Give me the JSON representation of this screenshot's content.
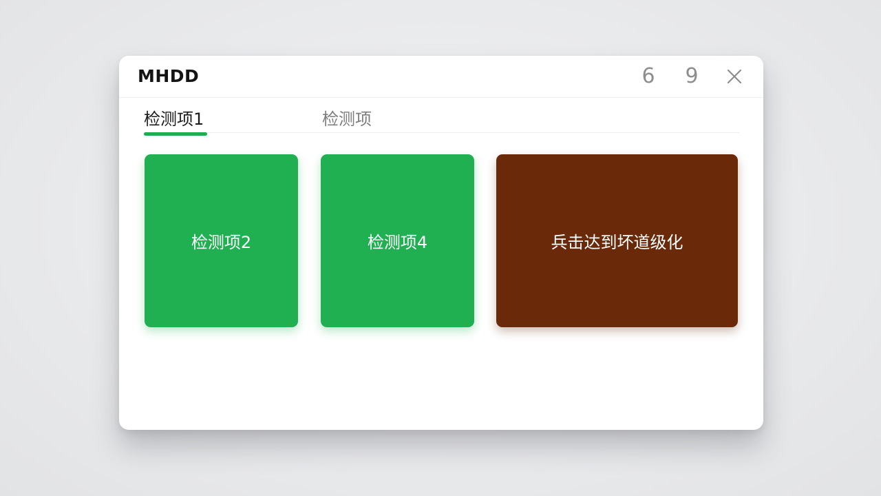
{
  "window": {
    "title": "MHDD",
    "controls": {
      "first": "6",
      "second": "9",
      "close_icon": "close-icon"
    }
  },
  "tabs": [
    {
      "label": "检测项1",
      "active": true
    },
    {
      "label": "检测项",
      "active": false
    }
  ],
  "cards": [
    {
      "label": "检测项2",
      "color": "#20b052"
    },
    {
      "label": "检测项4",
      "color": "#20b052"
    },
    {
      "label": "兵击达到坏道级化",
      "color": "#6a2a09"
    }
  ],
  "colors": {
    "accent": "#1fae4f",
    "danger": "#6a2a09",
    "background": "#e8e9eb"
  }
}
